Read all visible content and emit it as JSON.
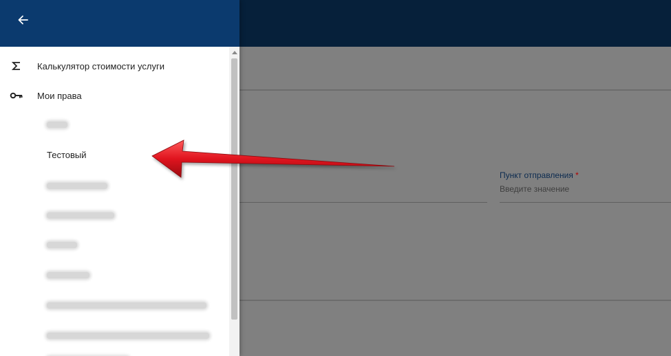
{
  "background_form": {
    "field_label": "Пункт отправления",
    "required_mark": "*",
    "field_placeholder": "Введите значение"
  },
  "drawer": {
    "back_icon": "arrow-left-icon",
    "items": [
      {
        "icon": "sigma-icon",
        "label": "Калькулятор стоимости услуги"
      },
      {
        "icon": "key-icon",
        "label": "Мои права"
      }
    ],
    "sub_items": [
      {
        "label": "Тестовый",
        "selected": true
      }
    ]
  },
  "annotation": {
    "arrow_color": "#e0141e",
    "pointing_to": "Тестовый"
  },
  "colors": {
    "topbar": "#06203a",
    "drawer_header": "#0b3a6e",
    "backdrop": "#808080"
  }
}
